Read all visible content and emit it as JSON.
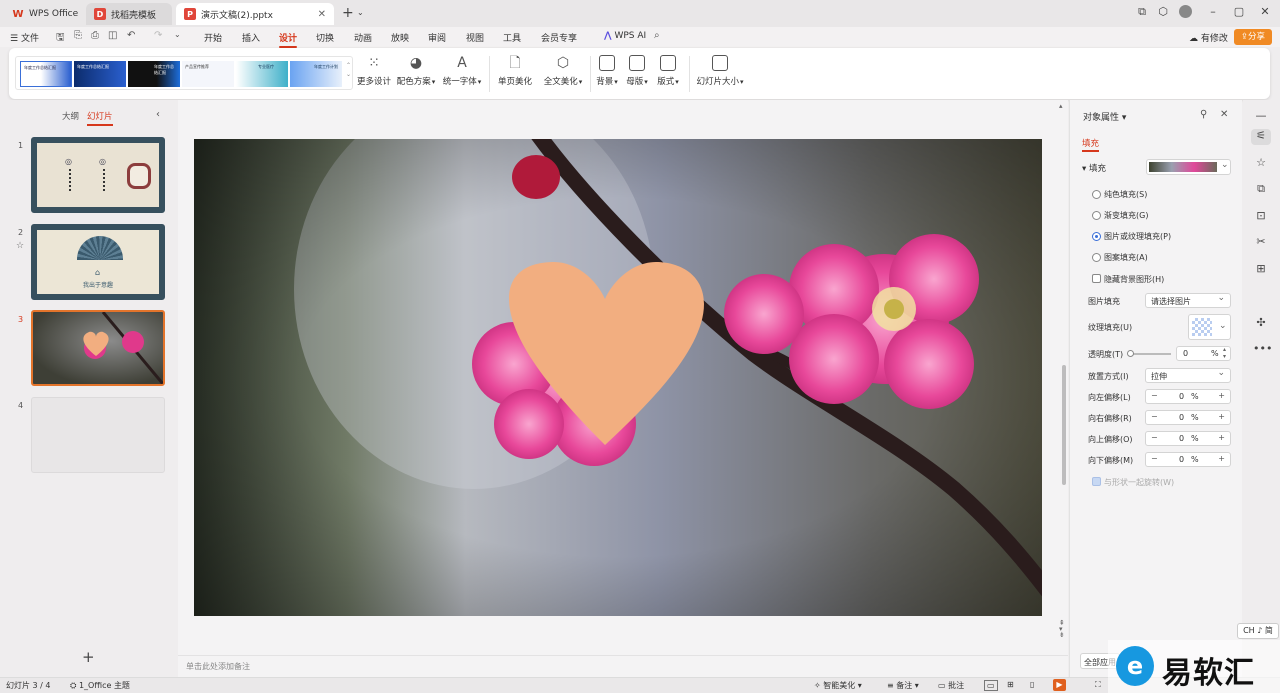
{
  "tabs": [
    {
      "label": "WPS Office",
      "icon": "wps-logo-icon"
    },
    {
      "label": "找稻壳模板",
      "icon": "docer-icon"
    },
    {
      "label": "演示文稿(2).pptx",
      "icon": "ppt-file-icon",
      "active": true
    }
  ],
  "menu": {
    "file": "文件",
    "items": [
      "开始",
      "插入",
      "设计",
      "切换",
      "动画",
      "放映",
      "审阅",
      "视图",
      "工具",
      "会员专享"
    ],
    "active": "设计",
    "wps_ai": "WPS AI",
    "edit_status": "有修改",
    "share": "分享"
  },
  "ribbon": {
    "template_thumbs": [
      "年度工作总结汇报",
      "年度工作总结汇报",
      "年度工作总结汇报",
      "产品宣传推荐",
      "专业医疗",
      "年度工作计划"
    ],
    "more_design": "更多设计",
    "color_scheme": "配色方案",
    "unify_font": "统一字体",
    "single_beautify": "单页美化",
    "full_beautify": "全文美化",
    "background": "背景",
    "master": "母版",
    "layout": "版式",
    "slide_size": "幻灯片大小"
  },
  "left_panel": {
    "tab_outline": "大纲",
    "tab_slides": "幻灯片",
    "slides": [
      "1",
      "2",
      "3",
      "4"
    ],
    "selected": 3,
    "slide2_text": "我出于意趣"
  },
  "notes_placeholder": "单击此处添加备注",
  "properties": {
    "title": "对象属性",
    "section_tab": "填充",
    "fill_header": "填充",
    "options": [
      {
        "label": "纯色填充(S)",
        "selected": false
      },
      {
        "label": "渐变填充(G)",
        "selected": false
      },
      {
        "label": "图片或纹理填充(P)",
        "selected": true
      },
      {
        "label": "图案填充(A)",
        "selected": false
      }
    ],
    "hide_bg": "隐藏背景图形(H)",
    "picture_fill_label": "图片填充",
    "picture_fill_value": "请选择图片",
    "texture_fill_label": "纹理填充(U)",
    "transparency_label": "透明度(T)",
    "transparency_value": "0",
    "transparency_unit": "%",
    "placement_label": "放置方式(I)",
    "placement_value": "拉伸",
    "offsets": [
      {
        "label": "向左偏移(L)",
        "value": "0",
        "unit": "%"
      },
      {
        "label": "向右偏移(R)",
        "value": "0",
        "unit": "%"
      },
      {
        "label": "向上偏移(O)",
        "value": "0",
        "unit": "%"
      },
      {
        "label": "向下偏移(M)",
        "value": "0",
        "unit": "%"
      }
    ],
    "rotate_with_shape": "与形状一起旋转(W)",
    "apply_all": "全部应用"
  },
  "ime": "CH ♪ 简",
  "status": {
    "slide_counter": "幻灯片 3 / 4",
    "theme": "1_Office 主题",
    "smart_beautify": "智能美化",
    "notes": "备注",
    "comments": "批注"
  },
  "watermark": "易软汇",
  "colors": {
    "accent": "#d6381c",
    "heart": "#f2ae80",
    "share_btn": "#f08a24"
  }
}
